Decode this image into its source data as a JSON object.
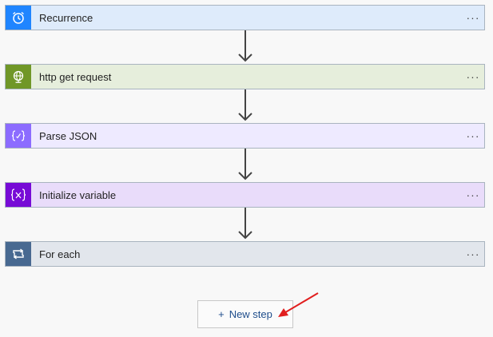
{
  "steps": [
    {
      "label": "Recurrence",
      "icon": "alarm-clock-icon",
      "accent": "#1f85ff",
      "bg": "#deebfb"
    },
    {
      "label": "http get request",
      "icon": "globe-icon",
      "accent": "#709727",
      "bg": "#e6eedc"
    },
    {
      "label": "Parse JSON",
      "icon": "braces-icon",
      "accent": "#8c6cff",
      "bg": "#eeeaff"
    },
    {
      "label": "Initialize variable",
      "icon": "variable-icon",
      "accent": "#770bd6",
      "bg": "#e9dcfa"
    },
    {
      "label": "For each",
      "icon": "loop-icon",
      "accent": "#486991",
      "bg": "#e2e6ec"
    }
  ],
  "more_label": "···",
  "new_step": {
    "plus": "+",
    "label": "New step"
  },
  "colors": {
    "connector": "#444444",
    "annotation_arrow": "#e11f1f"
  }
}
